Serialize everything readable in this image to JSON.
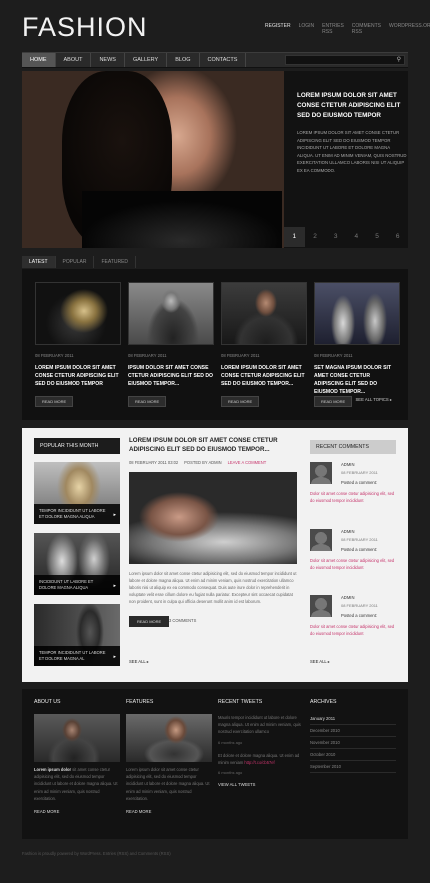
{
  "header": {
    "logo": "FASHION",
    "top_links": [
      "REGISTER",
      "LOGIN",
      "ENTRIES RSS",
      "COMMENTS RSS",
      "WORDPRESS.ORG"
    ]
  },
  "nav": {
    "items": [
      "HOME",
      "ABOUT",
      "NEWS",
      "GALLERY",
      "BLOG",
      "CONTACTS"
    ],
    "search_icon": "search-icon"
  },
  "slider": {
    "title": "LOREM IPSUM DOLOR SIT AMET CONSE CTETUR ADIPISCING ELIT SED DO EIUSMOD TEMPOR",
    "text": "LOREM IPSUM DOLOR SIT AMET CONSE CTETUR ADIPISCING ELIT SED DO EIUSMOD TEMPOR INCIDIDUNT UT LABORE ET DOLORE MAGNA ALIQUA. UT ENIM AD MINIM VENIAM, QUIS NOSTRUD EXERCITATION ULLAMCO LABORIS NISI UT ALIQUIP EX EA COMMODO.",
    "pages": [
      "1",
      "2",
      "3",
      "4",
      "5",
      "6"
    ]
  },
  "tabs": [
    "LATEST",
    "POPULAR",
    "FEATURED"
  ],
  "latest": {
    "cards": [
      {
        "date": "08 FEBRUARY 2011",
        "title": "LOREM IPSUM DOLOR SIT AMET CONSE CTETUR ADIPISCING ELIT SED DO EIUSMOD TEMPOR",
        "button": "READ MORE"
      },
      {
        "date": "08 FEBRUARY 2011",
        "title": "IPSUM DOLOR SIT AMET CONSE CTETUR ADIPISCING ELIT SED DO EIUSMOD TEMPOR...",
        "button": "READ MORE"
      },
      {
        "date": "08 FEBRUARY 2011",
        "title": "LOREM IPSUM DOLOR SIT AMET CONSE CTETUR ADIPISCING ELIT SED DO EIUSMOD TEMPOR...",
        "button": "READ MORE"
      },
      {
        "date": "08 FEBRUARY 2011",
        "title": "SET MAGNA IPSUM DOLOR SIT AMET CONSE CTETUR ADIPISCING ELIT SED DO EIUSMOD TEMPOR...",
        "button": "READ MORE"
      }
    ],
    "see_all": "SEE ALL TOPICS ▸"
  },
  "popular": {
    "title": "POPULAR THIS MONTH",
    "items": [
      "TEMPOR INCIDIDUNT UT LABORE ET DOLORE MAGNA ALIQUA",
      "INCIDIDUNT UT LABORE ET DOLORE MAGNA ALIQUA",
      "TEMPOR INCIDIDUNT UT LABORE ET DOLORE MAGNA AL"
    ]
  },
  "post": {
    "title": "LOREM IPSUM DOLOR SIT AMET CONSE CTETUR ADIPISCING ELIT SED DO EIUSMOD TEMPOR...",
    "date": "08 FEBRUARY 2011 03:02",
    "author": "POSTED BY ADMIN",
    "comment_link": "LEAVE A COMMENT",
    "text": "Lorem ipsum dolor sit amet conse ctetur adipisicing elit, sed do eiusmod tempor incididunt ut labore et dolore magna aliqua. Ut enim ad minim veniam, quis nostrud exercitation ullamco laboris nisi ut aliquip ex ea commodo consequat. Duis aute irure dolor in reprehenderit in voluptate velit esse cillum dolore eu fugiat nulla pariatur. Excepteur sint occaecat cupidatat non proident, sunt in culpa qui officia deserunt mollit anim id est laborum.",
    "button": "READ MORE",
    "comments": "3 COMMENTS",
    "see_all": "SEE ALL ▸"
  },
  "recent_comments": {
    "title": "RECENT COMMENTS",
    "items": [
      {
        "name": "ADMIN",
        "date": "08 FEBRUARY 2011",
        "action": "Posted a comment:",
        "text": "Dolor sit amet conse ctetur adipisicing elit, sed do eiusmod tempor incididunt"
      },
      {
        "name": "ADMIN",
        "date": "08 FEBRUARY 2011",
        "action": "Posted a comment:",
        "text": "Dolor sit amet conse ctetur adipisicing elit, sed do eiusmod tempor incididunt"
      },
      {
        "name": "ADMIN",
        "date": "08 FEBRUARY 2011",
        "action": "Posted a comment:",
        "text": "Dolor sit amet conse ctetur adipisicing elit, sed do eiusmod tempor incididunt"
      }
    ],
    "see_all": "SEE ALL ▸"
  },
  "footer": {
    "about": {
      "title": "ABOUT US",
      "lead": "Lorem ipsum dolor",
      "text": "sit amet conse ctetur adipisicing elit, sed do eiusmod tempor incididunt ut labore et dolore magna aliqua. Ut enim ad minim veniam, quis nostrud exercitation.",
      "more": "READ MORE"
    },
    "features": {
      "title": "FEATURES",
      "text": "Lorem ipsum dolor sit amet conse ctetur adipisicing elit, sed do eiusmod tempor incididunt ut labore et dolore magna aliqua. Ut enim ad minim veniam, quis nostrud exercitation.",
      "more": "READ MORE"
    },
    "tweets": {
      "title": "RECENT TWEETS",
      "items": [
        {
          "text": "Mauris tempor incididunt ut labore et dolore magna aliqua. Ut enim ad minim veniam, quis nostrud exercitation ullamco",
          "link": "",
          "time": "6 months ago"
        },
        {
          "text": "Et dolore et dolore magna aliqua. Ut enim ad minim veniam",
          "link": "http://t.co/cb57ef",
          "time": "6 months ago"
        }
      ],
      "more": "VIEW ALL TWEETS"
    },
    "archives": {
      "title": "ARCHIVES",
      "items": [
        "January 2011",
        "December 2010",
        "November 2010",
        "October 2010",
        "September 2010"
      ]
    }
  },
  "copyright": "Fashion is proudly powered by WordPress. Entries (RSS) and Comments (RSS)"
}
